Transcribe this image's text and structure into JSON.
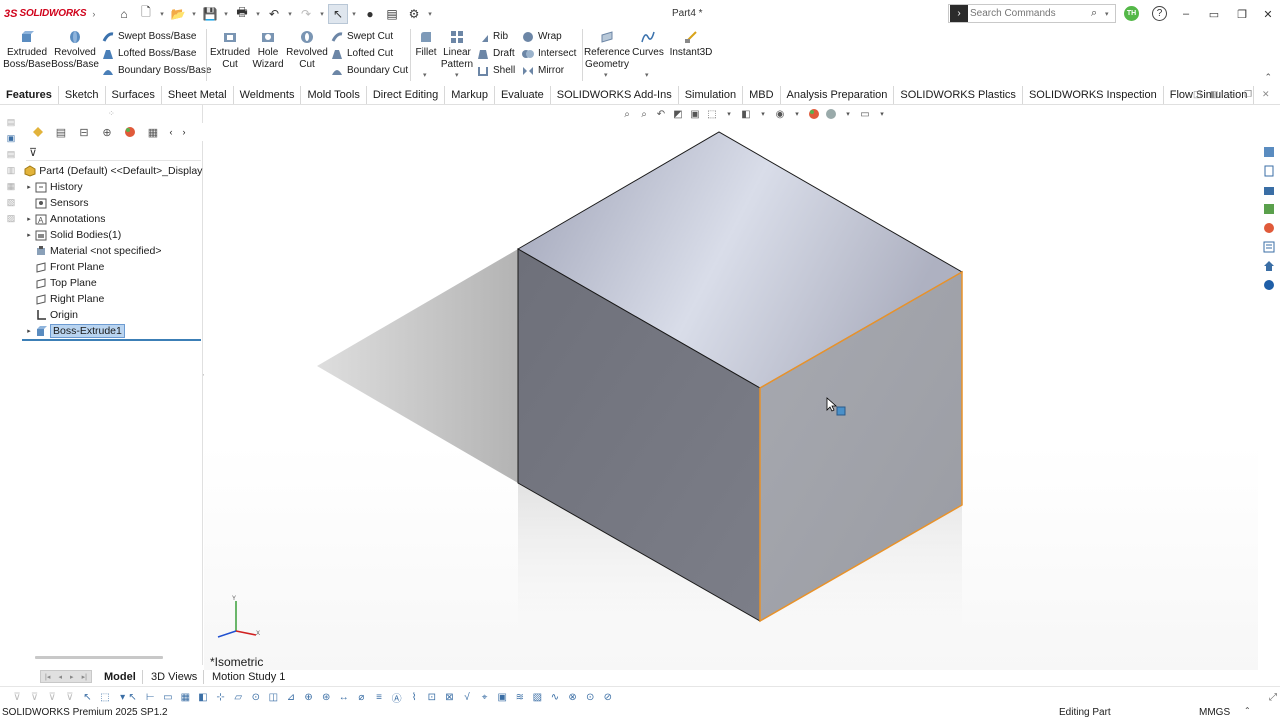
{
  "window": {
    "app_name": "SOLIDWORKS",
    "doc_title": "Part4 *",
    "search_placeholder": "Search Commands",
    "user_initials": "TH",
    "help_symbol": "?",
    "minimize_symbol": "–",
    "restore_symbol": "❐",
    "close_symbol": "✕"
  },
  "ribbon": {
    "extruded_boss": "Extruded Boss/Base",
    "revolved_boss": "Revolved Boss/Base",
    "swept_boss": "Swept Boss/Base",
    "lofted_boss": "Lofted Boss/Base",
    "boundary_boss": "Boundary Boss/Base",
    "extruded_cut": "Extruded Cut",
    "hole_wizard": "Hole Wizard",
    "revolved_cut": "Revolved Cut",
    "swept_cut": "Swept Cut",
    "lofted_cut": "Lofted Cut",
    "boundary_cut": "Boundary Cut",
    "fillet": "Fillet",
    "linear_pattern": "Linear Pattern",
    "rib": "Rib",
    "draft": "Draft",
    "shell": "Shell",
    "wrap": "Wrap",
    "intersect": "Intersect",
    "mirror": "Mirror",
    "reference_geometry": "Reference Geometry",
    "curves": "Curves",
    "instant3d": "Instant3D"
  },
  "tabs": [
    "Features",
    "Sketch",
    "Surfaces",
    "Sheet Metal",
    "Weldments",
    "Mold Tools",
    "Direct Editing",
    "Markup",
    "Evaluate",
    "SOLIDWORKS Add-Ins",
    "Simulation",
    "MBD",
    "Analysis Preparation",
    "SOLIDWORKS Plastics",
    "SOLIDWORKS Inspection",
    "Flow Simulation"
  ],
  "feature_tree": {
    "root": "Part4 (Default) <<Default>_Display S",
    "history": "History",
    "sensors": "Sensors",
    "annotations": "Annotations",
    "solid_bodies": "Solid Bodies(1)",
    "material": "Material <not specified>",
    "front_plane": "Front Plane",
    "top_plane": "Top Plane",
    "right_plane": "Right Plane",
    "origin": "Origin",
    "boss_extrude": "Boss-Extrude1"
  },
  "viewport": {
    "view_label": "*Isometric",
    "triad_y": "Y",
    "triad_x": "X"
  },
  "bottom_tabs": {
    "model": "Model",
    "views_3d": "3D Views",
    "motion_study": "Motion Study 1"
  },
  "status": {
    "product": "SOLIDWORKS Premium 2025 SP1.2",
    "mode": "Editing Part",
    "units": "MMGS"
  },
  "colors": {
    "brand": "#d0021b",
    "selection_edge": "#e8922a",
    "face_top": "#a7acc2",
    "face_left": "#73757f",
    "face_right": "#a2a4ab"
  }
}
